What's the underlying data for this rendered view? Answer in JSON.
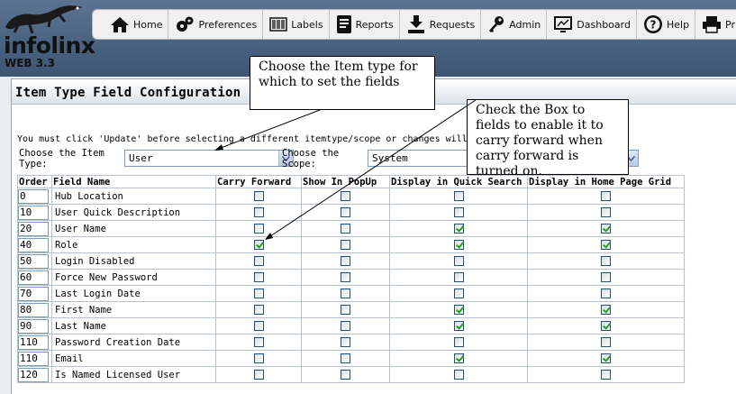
{
  "logo": {
    "name": "infolinx",
    "version": "WEB 3.3"
  },
  "nav": [
    {
      "label": "Home",
      "icon": "home-icon"
    },
    {
      "label": "Preferences",
      "icon": "gears-icon"
    },
    {
      "label": "Labels",
      "icon": "barcode-icon"
    },
    {
      "label": "Reports",
      "icon": "report-icon"
    },
    {
      "label": "Requests",
      "icon": "download-tray-icon"
    },
    {
      "label": "Admin",
      "icon": "key-icon"
    },
    {
      "label": "Dashboard",
      "icon": "monitor-icon"
    },
    {
      "label": "Help",
      "icon": "help-icon"
    },
    {
      "label": "Print",
      "icon": "printer-icon"
    }
  ],
  "panel": {
    "title": "Item Type Field Configuration",
    "notice": "You must click 'Update' before selecting a different itemtype/scope or changes will be lo",
    "item_type_label": "Choose the Item Type:",
    "item_type_value": "User",
    "scope_label": "Choose the Scope:",
    "scope_value": "System"
  },
  "table": {
    "headers": [
      "Order",
      "Field Name",
      "Carry Forward",
      "Show In PopUp",
      "Display in Quick Search",
      "Display in Home Page Grid"
    ],
    "rows": [
      {
        "order": "0",
        "name": "Hub Location",
        "carry": false,
        "popup": false,
        "quick": false,
        "home": false
      },
      {
        "order": "10",
        "name": "User Quick Description",
        "carry": false,
        "popup": false,
        "quick": false,
        "home": false
      },
      {
        "order": "20",
        "name": "User Name",
        "carry": false,
        "popup": false,
        "quick": true,
        "home": true
      },
      {
        "order": "40",
        "name": "Role",
        "carry": true,
        "popup": false,
        "quick": true,
        "home": true
      },
      {
        "order": "50",
        "name": "Login Disabled",
        "carry": false,
        "popup": false,
        "quick": false,
        "home": false
      },
      {
        "order": "60",
        "name": "Force New Password",
        "carry": false,
        "popup": false,
        "quick": false,
        "home": false
      },
      {
        "order": "70",
        "name": "Last Login Date",
        "carry": false,
        "popup": false,
        "quick": false,
        "home": false
      },
      {
        "order": "80",
        "name": "First Name",
        "carry": false,
        "popup": false,
        "quick": true,
        "home": true
      },
      {
        "order": "90",
        "name": "Last Name",
        "carry": false,
        "popup": false,
        "quick": true,
        "home": true
      },
      {
        "order": "110",
        "name": "Password Creation Date",
        "carry": false,
        "popup": false,
        "quick": false,
        "home": false
      },
      {
        "order": "110",
        "name": "Email",
        "carry": false,
        "popup": false,
        "quick": true,
        "home": true
      },
      {
        "order": "120",
        "name": "Is Named Licensed User",
        "carry": false,
        "popup": false,
        "quick": false,
        "home": false
      }
    ]
  },
  "callouts": {
    "item_type": "Choose the Item type for which to set the fields",
    "carry_forward": "Check the Box to fields to enable it to carry forward when carry forward is turned on."
  },
  "colors": {
    "header": "#4a6381",
    "check": "#21a121",
    "panel": "#ffffff"
  }
}
